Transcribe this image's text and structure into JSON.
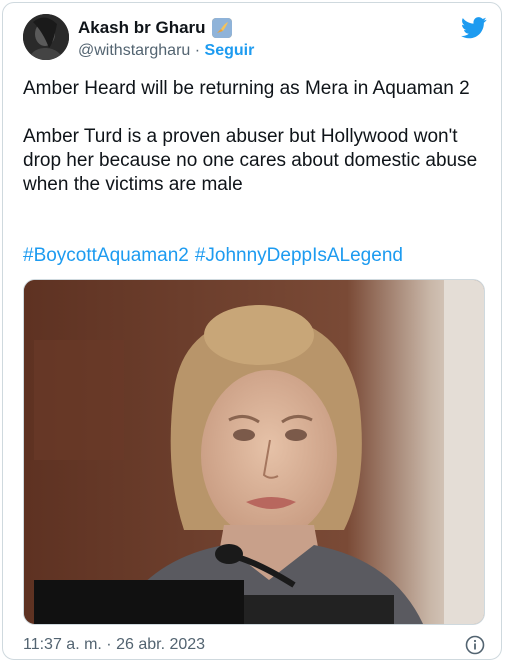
{
  "tweet": {
    "author_name": "Akash br Gharu",
    "handle": "@withstargharu",
    "separator": "·",
    "follow_label": "Seguir",
    "text": "Amber Heard will be returning as Mera in Aquaman 2\n\nAmber Turd is a proven abuser but Hollywood won't drop her because no one cares about domestic abuse when the victims are male",
    "hashtags": [
      "#BoycottAquaman2",
      "#JohnnyDeppIsALegend"
    ],
    "timestamp": "11:37 a. m. · 26 abr. 2023"
  },
  "icons": {
    "badge": "rocket-badge-icon",
    "platform": "twitter-bird-icon",
    "info": "info-icon"
  },
  "colors": {
    "accent": "#1d9bf0",
    "text": "#0f1419",
    "muted": "#536471"
  }
}
